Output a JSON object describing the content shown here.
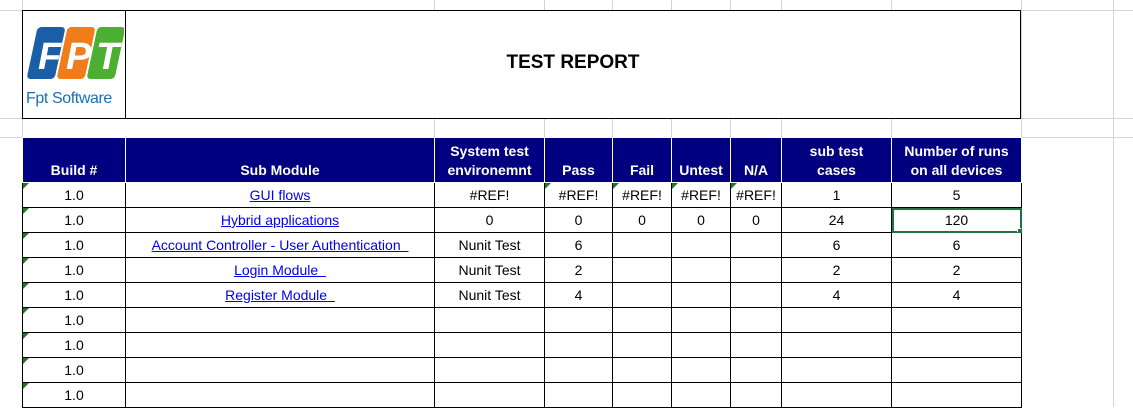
{
  "logo": {
    "letters": [
      "F",
      "P",
      "T"
    ],
    "text": "Fpt Software",
    "colors": [
      "#1a5ea8",
      "#f07d1a",
      "#4caf32"
    ]
  },
  "report_title": "TEST REPORT",
  "table": {
    "headers": {
      "build": "Build #",
      "sub_module": "Sub Module",
      "env_line1": "System test",
      "env_line2": "environemnt",
      "pass": "Pass",
      "fail": "Fail",
      "untest": "Untest",
      "na": "N/A",
      "cases_line1": "sub test",
      "cases_line2": "cases",
      "runs_line1": "Number of  runs",
      "runs_line2": "on all devices"
    },
    "rows": [
      {
        "build": "1.0",
        "sub_module": "GUI flows",
        "env": "#REF!",
        "pass": "#REF!",
        "fail": "#REF!",
        "untest": "#REF!",
        "na": "#REF!",
        "cases": "1",
        "runs": "5"
      },
      {
        "build": "1.0",
        "sub_module": "Hybrid applications",
        "env": "0",
        "pass": "0",
        "fail": "0",
        "untest": "0",
        "na": "0",
        "cases": "24",
        "runs": "120"
      },
      {
        "build": "1.0",
        "sub_module": "Account Controller - User Authentication  ",
        "env": "Nunit Test",
        "pass": "6",
        "fail": "",
        "untest": "",
        "na": "",
        "cases": "6",
        "runs": "6"
      },
      {
        "build": "1.0",
        "sub_module": "Login Module  ",
        "env": "Nunit Test",
        "pass": "2",
        "fail": "",
        "untest": "",
        "na": "",
        "cases": "2",
        "runs": "2"
      },
      {
        "build": "1.0",
        "sub_module": "Register Module  ",
        "env": "Nunit Test",
        "pass": "4",
        "fail": "",
        "untest": "",
        "na": "",
        "cases": "4",
        "runs": "4"
      },
      {
        "build": "1.0",
        "sub_module": "",
        "env": "",
        "pass": "",
        "fail": "",
        "untest": "",
        "na": "",
        "cases": "",
        "runs": ""
      },
      {
        "build": "1.0",
        "sub_module": "",
        "env": "",
        "pass": "",
        "fail": "",
        "untest": "",
        "na": "",
        "cases": "",
        "runs": ""
      },
      {
        "build": "1.0",
        "sub_module": "",
        "env": "",
        "pass": "",
        "fail": "",
        "untest": "",
        "na": "",
        "cases": "",
        "runs": ""
      },
      {
        "build": "1.0",
        "sub_module": "",
        "env": "",
        "pass": "",
        "fail": "",
        "untest": "",
        "na": "",
        "cases": "",
        "runs": ""
      }
    ]
  }
}
